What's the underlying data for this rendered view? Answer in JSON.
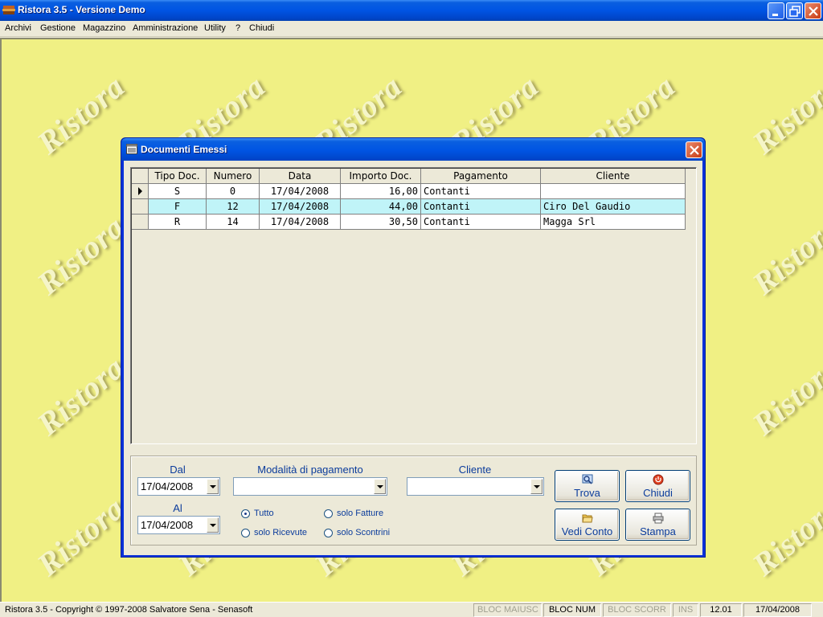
{
  "window": {
    "title": "Ristora 3.5 - Versione Demo",
    "icon": "app-icon"
  },
  "menu": [
    "Archivi",
    "Gestione",
    "Magazzino",
    "Amministrazione",
    "Utility",
    "?",
    "Chiudi"
  ],
  "watermark": "Ristora",
  "dialog": {
    "title": "Documenti Emessi",
    "icon": "document-icon",
    "grid": {
      "columns": [
        "Tipo Doc.",
        "Numero",
        "Data",
        "Importo Doc.",
        "Pagamento",
        "Cliente"
      ],
      "rows": [
        {
          "tipo": "S",
          "numero": "0",
          "data": "17/04/2008",
          "importo": "16,00",
          "pagamento": "Contanti",
          "cliente": ""
        },
        {
          "tipo": "F",
          "numero": "12",
          "data": "17/04/2008",
          "importo": "44,00",
          "pagamento": "Contanti",
          "cliente": "Ciro Del Gaudio"
        },
        {
          "tipo": "R",
          "numero": "14",
          "data": "17/04/2008",
          "importo": "30,50",
          "pagamento": "Contanti",
          "cliente": "Magga Srl"
        }
      ],
      "current_row": 0,
      "highlighted_row": 1,
      "highlight_color": "#c0f4f8"
    },
    "filters": {
      "dal_label": "Dal",
      "dal_value": "17/04/2008",
      "al_label": "Al",
      "al_value": "17/04/2008",
      "modalita_label": "Modalità di pagamento",
      "modalita_value": "",
      "cliente_label": "Cliente",
      "cliente_value": "",
      "radios": [
        {
          "label": "Tutto",
          "checked": true
        },
        {
          "label": "solo Fatture",
          "checked": false
        },
        {
          "label": "solo Ricevute",
          "checked": false
        },
        {
          "label": "solo Scontrini",
          "checked": false
        }
      ]
    },
    "buttons": {
      "trova": "Trova",
      "chiudi": "Chiudi",
      "vedi_conto": "Vedi Conto",
      "stampa": "Stampa"
    }
  },
  "statusbar": {
    "copyright": "Ristora 3.5 - Copyright © 1997-2008 Salvatore Sena - Senasoft",
    "bloc_maiusc": "BLOC MAIUSC",
    "bloc_num": "BLOC NUM",
    "bloc_scorr": "BLOC SCORR",
    "ins": "INS",
    "time": "12.01",
    "date": "17/04/2008"
  },
  "colors": {
    "desktop": "#f0f084",
    "label_blue": "#0b3c9c",
    "titlebar_blue": "#0054e3"
  }
}
